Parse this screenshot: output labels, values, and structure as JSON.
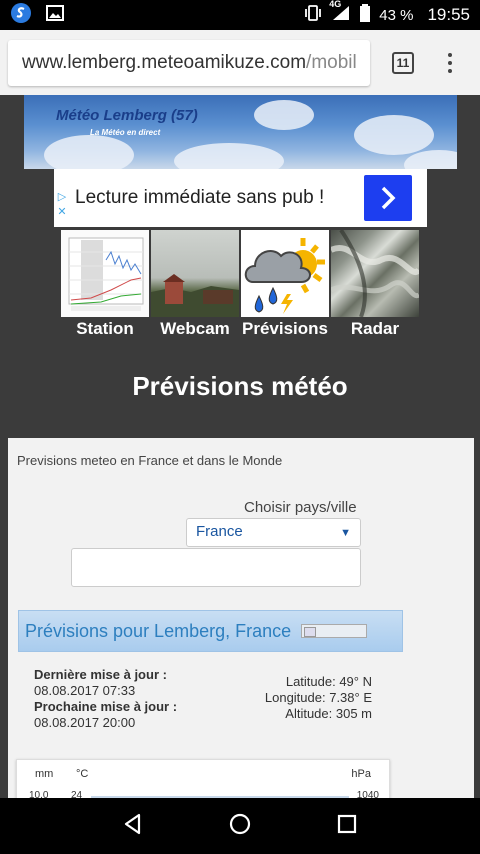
{
  "status_bar": {
    "network": "4G",
    "battery": "43 %",
    "time": "19:55"
  },
  "browser": {
    "url_main": "www.lemberg.meteoamikuze.com",
    "url_rest": "/mobil",
    "tab_count": "11"
  },
  "banner": {
    "title": "Météo Lemberg (57)",
    "subtitle": "La Météo en direct"
  },
  "ad": {
    "text": "Lecture immédiate sans pub !",
    "button_color": "#1d3ef0"
  },
  "nav": {
    "items": [
      {
        "label": "Station"
      },
      {
        "label": "Webcam"
      },
      {
        "label": "Prévisions"
      },
      {
        "label": "Radar"
      }
    ]
  },
  "page_title": "Prévisions météo",
  "panel": {
    "intro": "Previsions meteo en France et dans le Monde",
    "choose_label": "Choisir pays/ville",
    "country_selected": "France",
    "city_value": "",
    "forecast_title": "Prévisions pour Lemberg, France",
    "last_update_label": "Dernière mise à jour :",
    "last_update_value": "08.08.2017 07:33",
    "next_update_label": "Prochaine mise à jour :",
    "next_update_value": "08.08.2017 20:00",
    "latitude": "Latitude: 49° N",
    "longitude": "Longitude: 7.38° E",
    "altitude": "Altitude: 305 m"
  },
  "chart_header": {
    "mm": "mm",
    "celsius": "°C",
    "hpa": "hPa",
    "mm_value": "10.0",
    "celsius_value": "24",
    "hpa_value": "1040"
  }
}
